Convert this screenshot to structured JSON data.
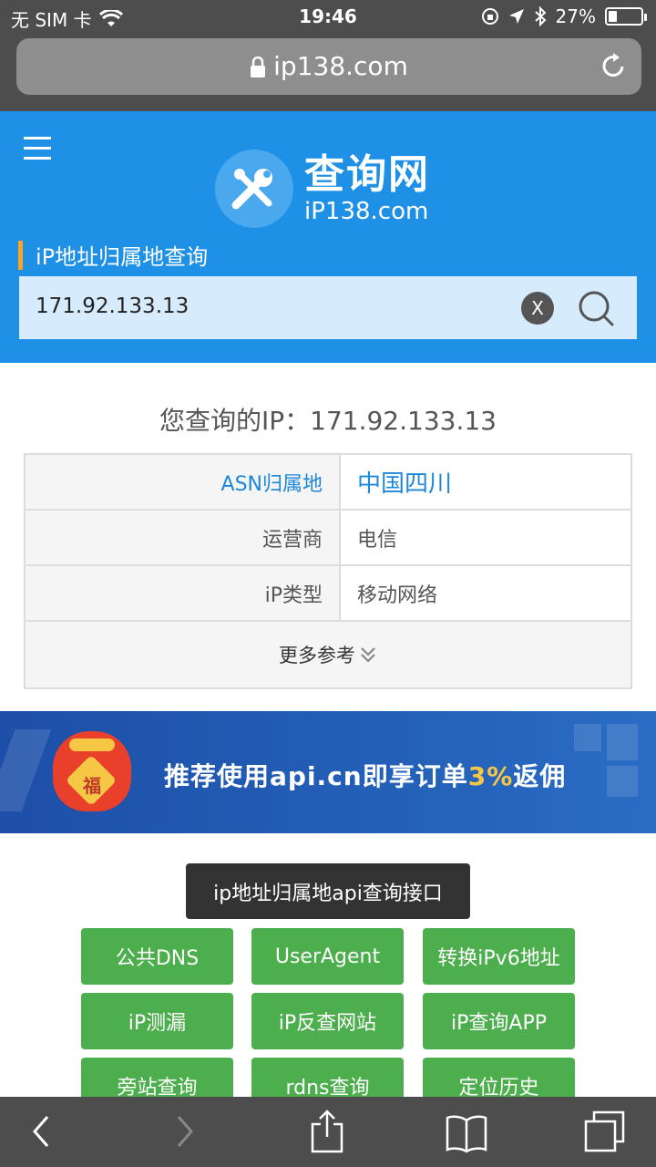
{
  "status": {
    "carrier": "无 SIM 卡",
    "time": "19:46",
    "battery_text": "27%",
    "battery_level": 0.27
  },
  "browser": {
    "url": "ip138.com"
  },
  "header": {
    "logo_big": "查询网",
    "logo_small": "iP138.com",
    "section_title": "iP地址归属地查询",
    "search_value": "171.92.133.13",
    "clear_label": "X"
  },
  "result": {
    "title": "您查询的IP：171.92.133.13",
    "rows": [
      {
        "label": "ASN归属地",
        "value": "中国四川"
      },
      {
        "label": "运营商",
        "value": "电信"
      },
      {
        "label": "iP类型",
        "value": "移动网络"
      }
    ],
    "more_label": "更多参考"
  },
  "banner": {
    "text_before": "推荐使用api.cn即享订单",
    "text_pct": "3%",
    "text_after": "返佣",
    "bag_char": "福"
  },
  "api_button": "ip地址归属地api查询接口",
  "tools": [
    "公共DNS",
    "UserAgent",
    "转换iPv6地址",
    "iP测漏",
    "iP反查网站",
    "iP查询APP",
    "旁站查询",
    "rdns查询",
    "定位历史"
  ],
  "colors": {
    "brand_blue": "#1e90e6",
    "search_bg": "#d6ebfb",
    "accent_orange": "#f5a623",
    "link_blue": "#1e88d8",
    "green": "#4cae4c",
    "chrome_gray": "#4d4d4d"
  },
  "icons": [
    "wifi-icon",
    "lock-icon",
    "reload-icon",
    "menu-icon",
    "wrench-icon",
    "search-icon",
    "chevron-double-down-icon",
    "back-icon",
    "forward-icon",
    "share-icon",
    "bookmarks-icon",
    "tabs-icon"
  ]
}
